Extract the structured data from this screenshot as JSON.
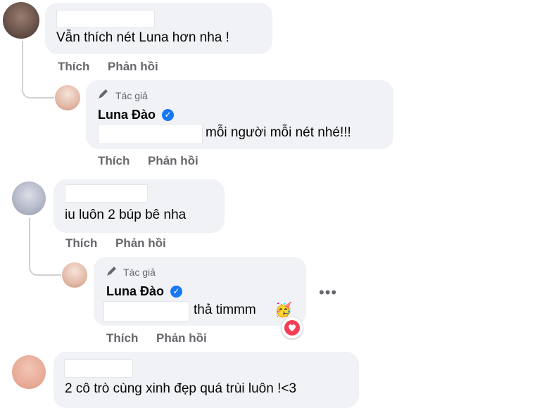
{
  "comments": [
    {
      "text": "Vẫn thích nét Luna hơn nha !",
      "actions": {
        "like": "Thích",
        "reply": "Phản hồi"
      },
      "reply": {
        "author_tag": "Tác giả",
        "author_name": "Luna Đào",
        "text": "mỗi người mỗi nét nhé!!!",
        "actions": {
          "like": "Thích",
          "reply": "Phản hồi"
        }
      }
    },
    {
      "text": "iu luôn 2 búp bê nha",
      "actions": {
        "like": "Thích",
        "reply": "Phản hồi"
      },
      "reply": {
        "author_tag": "Tác giả",
        "author_name": "Luna Đào",
        "text": "thả timmm",
        "emoji": "🥳",
        "reaction_icon": "heart",
        "more_options": "•••",
        "actions": {
          "like": "Thích",
          "reply": "Phản hồi"
        }
      }
    },
    {
      "text": "2 cô trò cùng xinh đẹp quá trùi luôn !<3"
    }
  ],
  "colors": {
    "bubble": "#f0f2f5",
    "secondary_text": "#65676b",
    "verified": "#1877f2",
    "heart": "#f33e58"
  }
}
